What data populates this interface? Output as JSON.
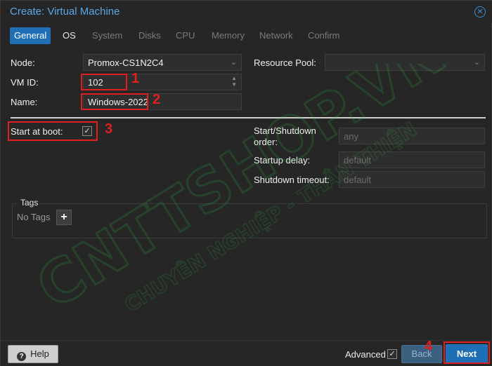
{
  "window": {
    "title": "Create: Virtual Machine",
    "close_icon": "close-icon"
  },
  "tabs": [
    {
      "label": "General",
      "state": "active"
    },
    {
      "label": "OS",
      "state": "enabled"
    },
    {
      "label": "System",
      "state": "disabled"
    },
    {
      "label": "Disks",
      "state": "disabled"
    },
    {
      "label": "CPU",
      "state": "disabled"
    },
    {
      "label": "Memory",
      "state": "disabled"
    },
    {
      "label": "Network",
      "state": "disabled"
    },
    {
      "label": "Confirm",
      "state": "disabled"
    }
  ],
  "form": {
    "node_label": "Node:",
    "node_value": "Promox-CS1N2C4",
    "vmid_label": "VM ID:",
    "vmid_value": "102",
    "name_label": "Name:",
    "name_value": "Windows-2022",
    "resource_pool_label": "Resource Pool:",
    "resource_pool_value": "",
    "start_at_boot_label": "Start at boot:",
    "start_at_boot_checked": true,
    "startup_order_label": "Start/Shutdown order:",
    "startup_order_placeholder": "any",
    "startup_delay_label": "Startup delay:",
    "startup_delay_placeholder": "default",
    "shutdown_timeout_label": "Shutdown timeout:",
    "shutdown_timeout_placeholder": "default"
  },
  "tags": {
    "title": "Tags",
    "empty_text": "No Tags",
    "add_label": "+"
  },
  "annotations": [
    "1",
    "2",
    "3",
    "4"
  ],
  "footer": {
    "help_label": "Help",
    "advanced_label": "Advanced",
    "advanced_checked": true,
    "back_label": "Back",
    "next_label": "Next"
  },
  "watermark": {
    "line1": "CNTTSHOP.VN",
    "line2": "CHUYÊN NGHIỆP - THÂN THIỆN"
  },
  "colors": {
    "accent": "#1f6fb6",
    "title": "#5aa7e6",
    "annotation": "#e02020"
  }
}
